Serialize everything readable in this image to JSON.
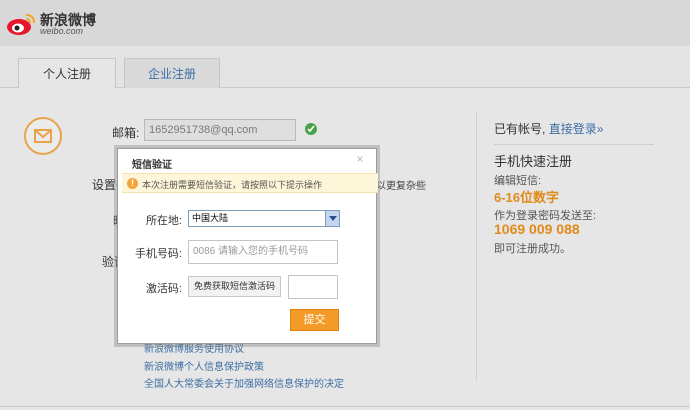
{
  "brand": {
    "name": "新浪微博",
    "sub": "weibo.com"
  },
  "tabs": [
    {
      "label": "个人注册"
    },
    {
      "label": "企业注册"
    }
  ],
  "form": {
    "email_label": "邮箱:",
    "email_value": "1652951738@qq.com",
    "password_label_partial": "设置密",
    "nickname_label_partial": "昵",
    "verify_label_partial": "验证",
    "bg_hint": "以更复杂些"
  },
  "footer_links": [
    "新浪微博服务使用协议",
    "新浪微博个人信息保护政策",
    "全国人大常委会关于加强网络信息保护的决定"
  ],
  "right": {
    "has_account": "已有帐号,",
    "login_link": "直接登录»",
    "quick_title": "手机快速注册",
    "edit_sms": "编辑短信:",
    "digits": "6-16位数字",
    "send_to": "作为登录密码发送至:",
    "number": "1069 009 088",
    "done": "即可注册成功。"
  },
  "dialog": {
    "title": "短信验证",
    "close": "×",
    "notice": "本次注册需要短信验证，请按照以下提示操作",
    "location_label": "所在地:",
    "location_value": "中国大陆",
    "phone_label": "手机号码:",
    "phone_placeholder": "0086  请输入您的手机号码",
    "code_label": "激活码:",
    "get_code_button": "免费获取短信激活码",
    "submit_button": "提交"
  },
  "colors": {
    "accent_orange": "#f39a28",
    "link_blue": "#3c6ea5",
    "success_green": "#4ba04b"
  }
}
